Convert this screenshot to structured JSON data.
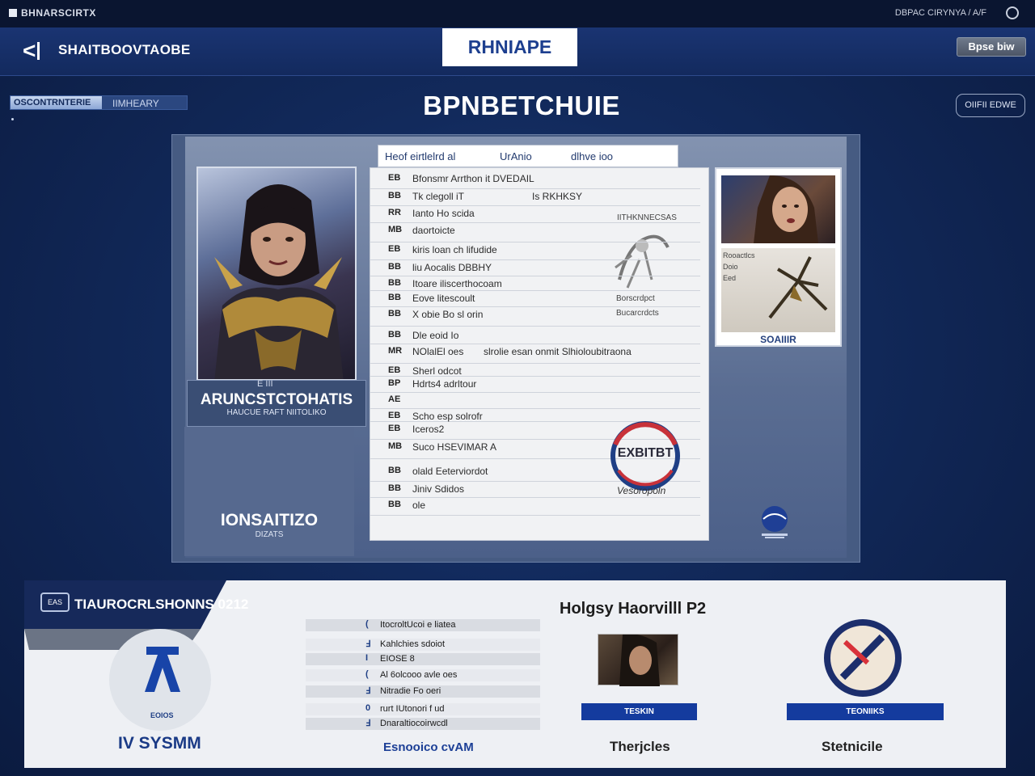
{
  "system_bar": {
    "title": "BHNARSCIRTX",
    "right_text": "DBPAC CIRYNYA / A/F"
  },
  "nav": {
    "back_icon": "back-chevron-icon",
    "title": "SHAITBOOVTAOBE",
    "active_tab": "RHNIAPE",
    "right_button": "Bpse biw"
  },
  "subheader": {
    "progress_text": "OSCONTRNTERIE",
    "progress_label": "IIMHEARY",
    "progress_fraction": 0.52,
    "page_title": "BPNBETCHUIE",
    "pill_button": "OIIFII EDWE"
  },
  "hero": {
    "tag": "E III",
    "name": "ARUNCSTCTOHATIS",
    "subtitle": "HAUCUE RAFT NIITOLIKO",
    "stat": "IONSAITIZO",
    "stat_label": "DIZATS"
  },
  "document": {
    "tabs": [
      "Heof eirtlelrd al",
      "UrAnio",
      "dlhve ioo"
    ],
    "rows": [
      {
        "num": "EB",
        "text": "Bfonsmr Arrthon it DVEDAIL",
        "text2": ""
      },
      {
        "num": "BB",
        "text": "Tk clegoll iT",
        "text2": "Is  RKHKSY"
      },
      {
        "num": "RR",
        "text": "Ianto Ho scida",
        "text2": ""
      },
      {
        "num": "MB",
        "text": "daortoicte",
        "text2": ""
      },
      {
        "num": "EB",
        "text": "kiris loan ch lifudide",
        "text2": ""
      },
      {
        "num": "BB",
        "text": "liu  Aocalis DBBHY",
        "text2": ""
      },
      {
        "num": "BB",
        "text": "Itoare iliscerthocoam",
        "text2": ""
      },
      {
        "num": "BB",
        "text": "Eove litescoult",
        "text2": ""
      },
      {
        "num": "BB",
        "text": "X obie Bo sl orin",
        "text2": ""
      },
      {
        "num": "BB",
        "text": "Dle eoid Io",
        "text2": ""
      },
      {
        "num": "MR",
        "text": "NOlalEl oes",
        "text2": "slrolie esan onmit Slhioloubitraona"
      },
      {
        "num": "EB",
        "text": "Sherl odcot",
        "text2": ""
      },
      {
        "num": "BP",
        "text": "Hdrts4 adrltour",
        "text2": ""
      },
      {
        "num": "AE",
        "text": "",
        "text2": ""
      },
      {
        "num": "EB",
        "text": "Scho esp solrofr",
        "text2": ""
      },
      {
        "num": "EB",
        "text": "Iceros2",
        "text2": ""
      },
      {
        "num": "MB",
        "text": "Suco HSEVIMAR A",
        "text2": ""
      },
      {
        "num": "BB",
        "text": "olald Eeterviordot",
        "text2": ""
      },
      {
        "num": "BB",
        "text": "Jiniv Sdidos",
        "text2": ""
      },
      {
        "num": "BB",
        "text": "ole",
        "text2": ""
      }
    ],
    "annotation_top": "IITHKNNECSAS",
    "annotation_mid1": "Borscrdpct",
    "annotation_mid2": "Bucarcrdcts",
    "stamp_text": "EXBITBT",
    "stamp_signature": "Vesoropoln"
  },
  "side_card": {
    "labels": [
      "Rooactlcs",
      "Doio",
      "Eed"
    ],
    "caption": "SOAIIIR"
  },
  "bottom": {
    "tab_badge": "EAS",
    "tab_title": "TIAUROCRLSHONNS 0212",
    "stat_label": "EOIOS",
    "stat_big": "IV SYSMM",
    "list": [
      {
        "icon": "(",
        "text": "ItocroltUcoi e  liatea"
      },
      {
        "icon": "Ⅎ",
        "text": "Kahlchies sdoiot"
      },
      {
        "icon": "I",
        "text": "EIOSE 8"
      },
      {
        "icon": "(",
        "text": "Al 6olcooo avle oes"
      },
      {
        "icon": "Ⅎ",
        "text": "Nitradie Fo oeri"
      },
      {
        "icon": "0",
        "text": "rurt IUtonori f ud"
      },
      {
        "icon": "Ⅎ",
        "text": "Dnaraltiocoirwcdl"
      }
    ],
    "list_footer": "Esnooico cvAM",
    "center_heading": "Holgsy Haorvilll P2",
    "center_button": "TESKIN",
    "center_footer": "Therjcles",
    "right_button": "TEONIIKS",
    "right_footer": "Stetnicile"
  }
}
